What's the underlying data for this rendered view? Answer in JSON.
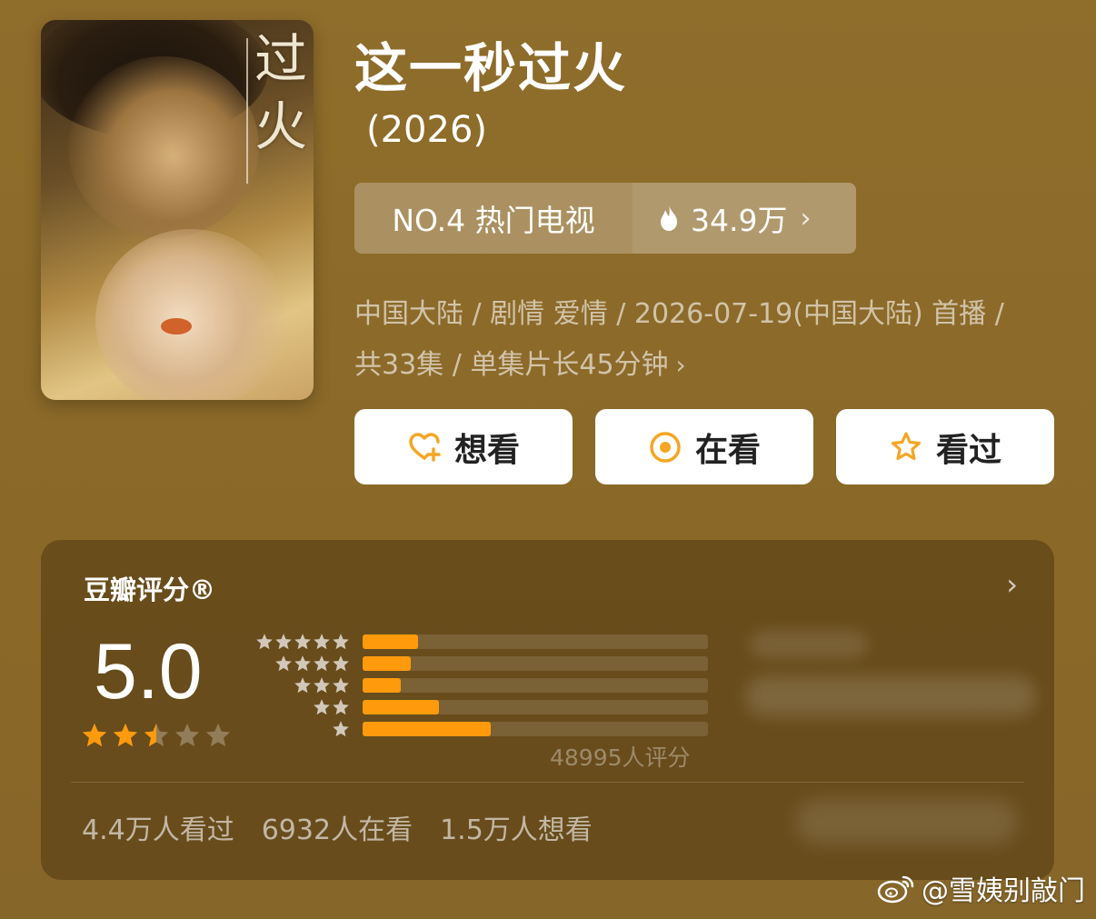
{
  "title": "这一秒过火",
  "year": "(2026)",
  "rank": {
    "label": "NO.4 热门电视",
    "heat": "34.9万",
    "chevron": "›"
  },
  "meta": {
    "line1": "中国大陆 / 剧情 爱情 / 2026-07-19(中国大陆) 首播 /",
    "line2": "共33集 / 单集片长45分钟",
    "chevron": "›"
  },
  "poster": {
    "title_glyphs": "过火",
    "icon": "poster-image"
  },
  "actions": [
    {
      "label": "想看",
      "icon": "heart-plus-icon"
    },
    {
      "label": "在看",
      "icon": "target-circle-icon"
    },
    {
      "label": "看过",
      "icon": "star-outline-icon"
    }
  ],
  "rating": {
    "title": "豆瓣评分®",
    "score": "5.0",
    "stars": 2.5,
    "distribution": [
      {
        "stars": 5,
        "fraction": 0.16
      },
      {
        "stars": 4,
        "fraction": 0.14
      },
      {
        "stars": 3,
        "fraction": 0.11
      },
      {
        "stars": 2,
        "fraction": 0.22
      },
      {
        "stars": 1,
        "fraction": 0.37
      }
    ],
    "raters": "48995人评分",
    "chevron": "›"
  },
  "counts": {
    "watched": "4.4万人看过",
    "watching": "6932人在看",
    "wish": "1.5万人想看"
  },
  "watermark": "@雪姨别敲门",
  "colors": {
    "accent": "#ff9a0c",
    "background": "#8c6b2a"
  }
}
